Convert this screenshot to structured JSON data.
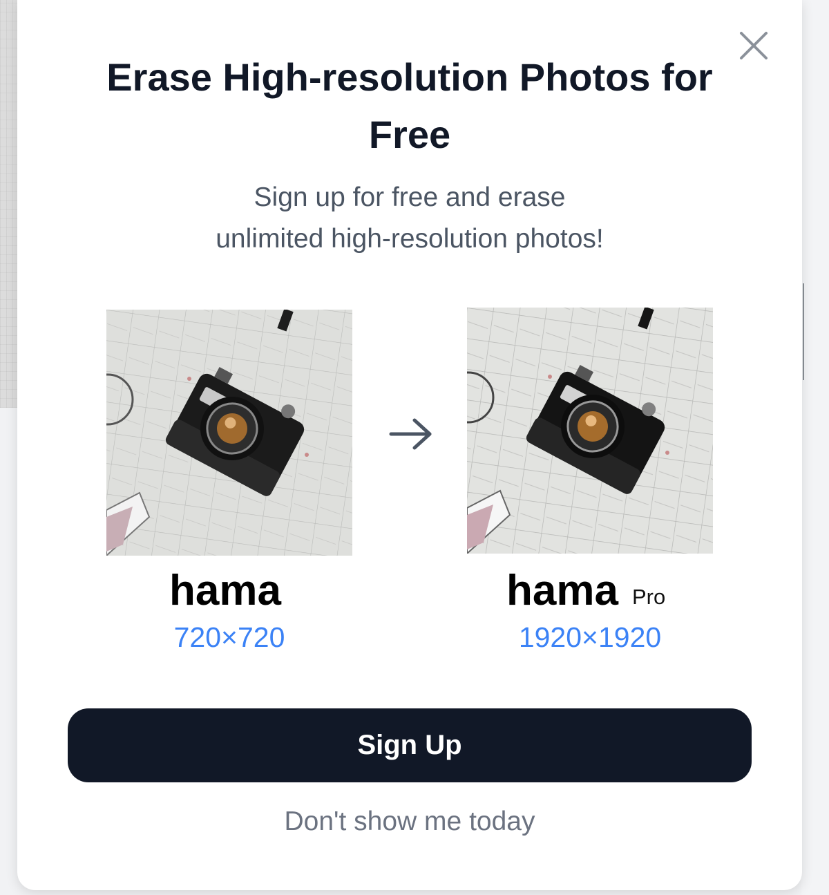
{
  "modal": {
    "title": "Erase High-resolution Photos for Free",
    "subtitle_line1": "Sign up for free and erase",
    "subtitle_line2": "unlimited high-resolution photos!",
    "close_icon": "close-icon",
    "arrow_icon": "arrow-right-icon"
  },
  "comparison": {
    "left": {
      "brand": "hama",
      "resolution": "720×720",
      "image": "camera-on-map-photo"
    },
    "right": {
      "brand": "hama",
      "brand_suffix": "Pro",
      "resolution": "1920×1920",
      "image": "camera-on-map-photo"
    }
  },
  "actions": {
    "signup_label": "Sign Up",
    "dismiss_label": "Don't show me today"
  },
  "colors": {
    "primary_button": "#111827",
    "resolution_text": "#3b82f6",
    "title_text": "#111827",
    "subtitle_text": "#4b5563",
    "dismiss_text": "#6b7280"
  }
}
